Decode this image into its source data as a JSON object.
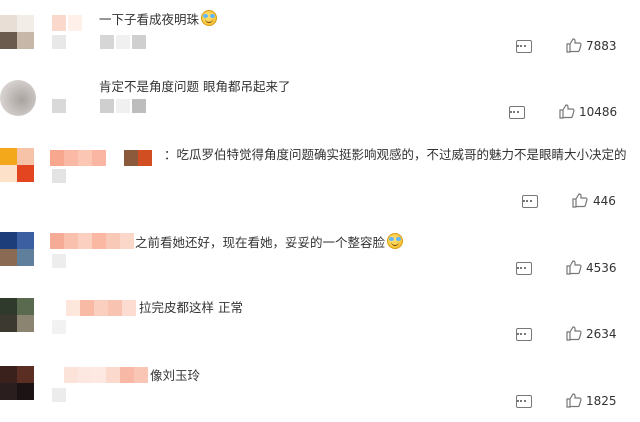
{
  "comments": [
    {
      "text": "一下子看成夜明珠",
      "emoji": "laugh-cry-icon",
      "likes": "7883"
    },
    {
      "text": "肯定不是角度问题 眼角都吊起来了",
      "likes": "10486"
    },
    {
      "text": "：吃瓜罗伯特觉得角度问题确实挺影响观感的，不过威哥的魅力不是眼睛大小决定的",
      "likes": "446"
    },
    {
      "text": "之前看她还好，现在看她，妥妥的一个整容脸",
      "emoji": "laugh-cry-icon",
      "likes": "4536"
    },
    {
      "text": "拉完皮都这样 正常",
      "likes": "2634"
    },
    {
      "text": "像刘玉玲",
      "likes": "1825"
    }
  ],
  "colors": {
    "text": "#333333",
    "icon": "#777777",
    "background": "#ffffff"
  }
}
